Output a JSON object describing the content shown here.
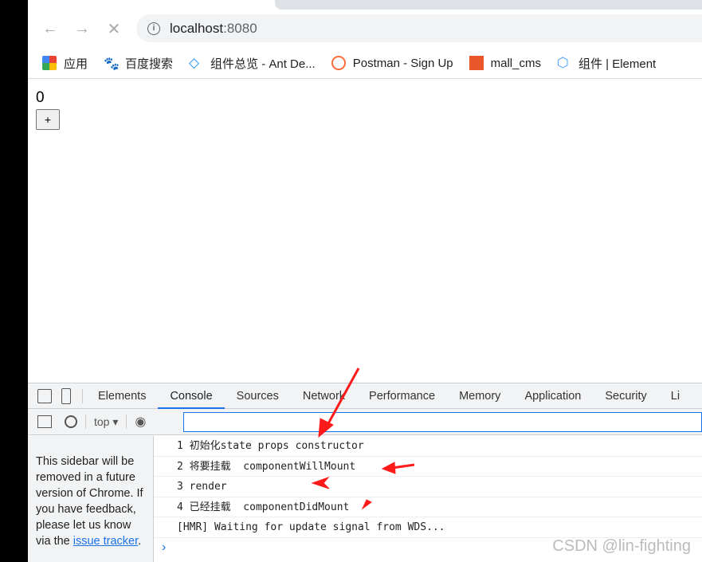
{
  "browser": {
    "url_host": "localhost",
    "url_port": ":8080",
    "bookmarks": [
      {
        "label": "应用",
        "icon": "apps-grid-icon"
      },
      {
        "label": "百度搜索",
        "icon": "baidu-icon"
      },
      {
        "label": "组件总览 - Ant De...",
        "icon": "ant-design-icon"
      },
      {
        "label": "Postman - Sign Up",
        "icon": "postman-icon"
      },
      {
        "label": "mall_cms",
        "icon": "mall-cms-icon"
      },
      {
        "label": "组件 | Element",
        "icon": "element-icon"
      }
    ]
  },
  "page": {
    "count": "0",
    "plus_label": "+"
  },
  "devtools": {
    "tabs": [
      "Elements",
      "Console",
      "Sources",
      "Network",
      "Performance",
      "Memory",
      "Application",
      "Security",
      "Li"
    ],
    "active_tab": "Console",
    "context": "top",
    "sidebar_text": "This sidebar will be removed in a future version of Chrome. If you have feedback, please let us know via the ",
    "sidebar_link": "issue tracker",
    "sidebar_end": ".",
    "logs": [
      "1 初始化state props constructor",
      "2 将要挂载  componentWillMount",
      "3 render",
      "4 已经挂载  componentDidMount",
      "[HMR] Waiting for update signal from WDS..."
    ],
    "prompt": "›"
  },
  "watermark": "CSDN @lin-fighting",
  "annotation_color": "#ff1a1a"
}
